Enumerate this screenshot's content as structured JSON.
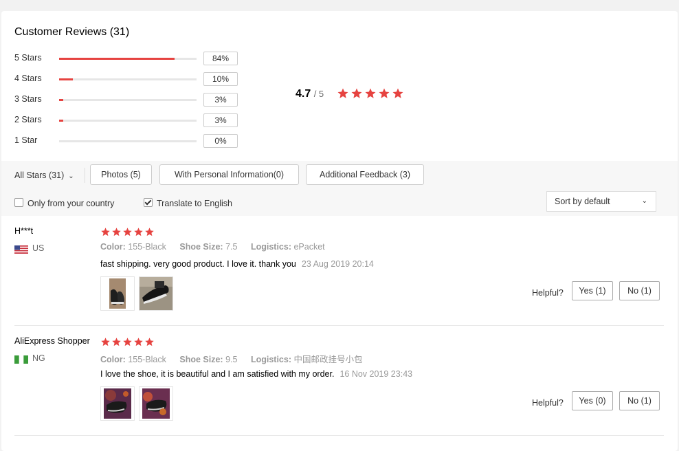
{
  "title": "Customer Reviews (31)",
  "accent_color": "#e64340",
  "distribution": [
    {
      "label": "5 Stars",
      "percent_text": "84%",
      "fraction": 0.84
    },
    {
      "label": "4 Stars",
      "percent_text": "10%",
      "fraction": 0.1
    },
    {
      "label": "3 Stars",
      "percent_text": "3%",
      "fraction": 0.03
    },
    {
      "label": "2 Stars",
      "percent_text": "3%",
      "fraction": 0.03
    },
    {
      "label": "1 Star",
      "percent_text": "0%",
      "fraction": 0.0
    }
  ],
  "average": {
    "value": "4.7",
    "out_of": "/ 5",
    "stars": 5
  },
  "filters": {
    "all_stars": "All Stars (31)",
    "photos": "Photos (5)",
    "personal": "With Personal Information(0)",
    "additional": "Additional Feedback (3)",
    "only_country": "Only from your country",
    "translate": "Translate to English",
    "translate_checked": true,
    "only_country_checked": false,
    "sort": "Sort by default"
  },
  "reviews": [
    {
      "name": "H***t",
      "country": "US",
      "flag": "us-flag-icon",
      "stars": 5,
      "color_label": "Color:",
      "color": "155-Black",
      "size_label": "Shoe Size:",
      "size": "7.5",
      "logistics_label": "Logistics:",
      "logistics": "ePacket",
      "text": "fast shipping. very good product. I love it. thank you",
      "date": "23 Aug 2019 20:14",
      "helpful": "Helpful?",
      "yes": "Yes (1)",
      "no": "No (1)"
    },
    {
      "name": "AliExpress Shopper",
      "country": "NG",
      "flag": "ng-flag-icon",
      "stars": 5,
      "color_label": "Color:",
      "color": "155-Black",
      "size_label": "Shoe Size:",
      "size": "9.5",
      "logistics_label": "Logistics:",
      "logistics": "中国邮政挂号小包",
      "text": "I love the shoe, it is beautiful and I am satisfied with my order.",
      "date": "16 Nov 2019 23:43",
      "helpful": "Helpful?",
      "yes": "Yes (0)",
      "no": "No (1)"
    }
  ]
}
